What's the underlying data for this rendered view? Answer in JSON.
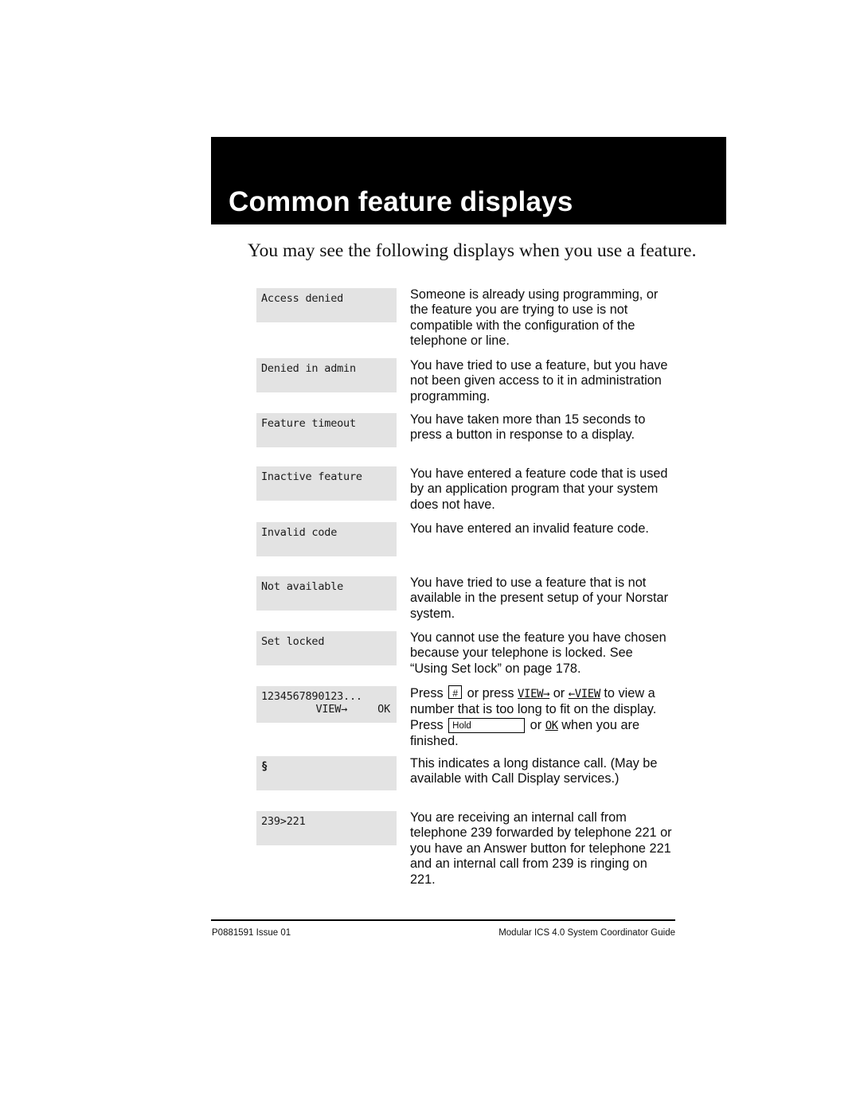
{
  "header": {
    "title": "Common feature displays"
  },
  "intro": "You may see the following displays when you use a feature.",
  "rows": [
    {
      "display_lines": [
        "Access denied"
      ],
      "description": "Someone is already using programming, or the feature you are trying to use is not compatible with the configuration of the telephone or line."
    },
    {
      "display_lines": [
        "Denied in admin"
      ],
      "description": "You have tried to use a feature, but you have not been given access to it in administration programming."
    },
    {
      "display_lines": [
        "Feature timeout"
      ],
      "description": "You have taken more than 15 seconds to press a button in response to a display."
    },
    {
      "display_lines": [
        "Inactive feature"
      ],
      "description": "You have entered a feature code that is used by an application program that your system does not have."
    },
    {
      "display_lines": [
        "Invalid code"
      ],
      "description": "You have entered an invalid feature code."
    },
    {
      "display_lines": [
        "Not available"
      ],
      "description": "You have tried to use a feature that is not available in the present setup of your Norstar system."
    },
    {
      "display_lines": [
        "Set locked"
      ],
      "description": "You cannot use the feature you have chosen because your telephone is locked. See “Using Set lock” on page 178."
    },
    {
      "display_lines": [
        "1234567890123..."
      ],
      "softkeys": {
        "middle": "VIEW→",
        "right": "OK"
      },
      "description_parts": {
        "p1": "Press ",
        "key1": "#",
        "p2": " or press ",
        "softkey1": "VIEW→",
        "p3": " or ",
        "softkey2": "←VIEW",
        "p4": " to view a number that is too long to fit on the display. Press ",
        "key2": "Hold",
        "p5": " or ",
        "softkey3": "OK",
        "p6": " when you are finished."
      }
    },
    {
      "display_lines": [
        "§"
      ],
      "description": "This indicates a long distance call. (May be available with Call Display services.)"
    },
    {
      "display_lines": [
        "239>221"
      ],
      "description": "You are receiving an internal call from telephone 239 forwarded by telephone 221 or you have an Answer button for telephone 221 and an internal call from 239 is ringing on 221."
    }
  ],
  "footer": {
    "left": "P0881591 Issue 01",
    "right": "Modular ICS 4.0 System Coordinator Guide"
  }
}
